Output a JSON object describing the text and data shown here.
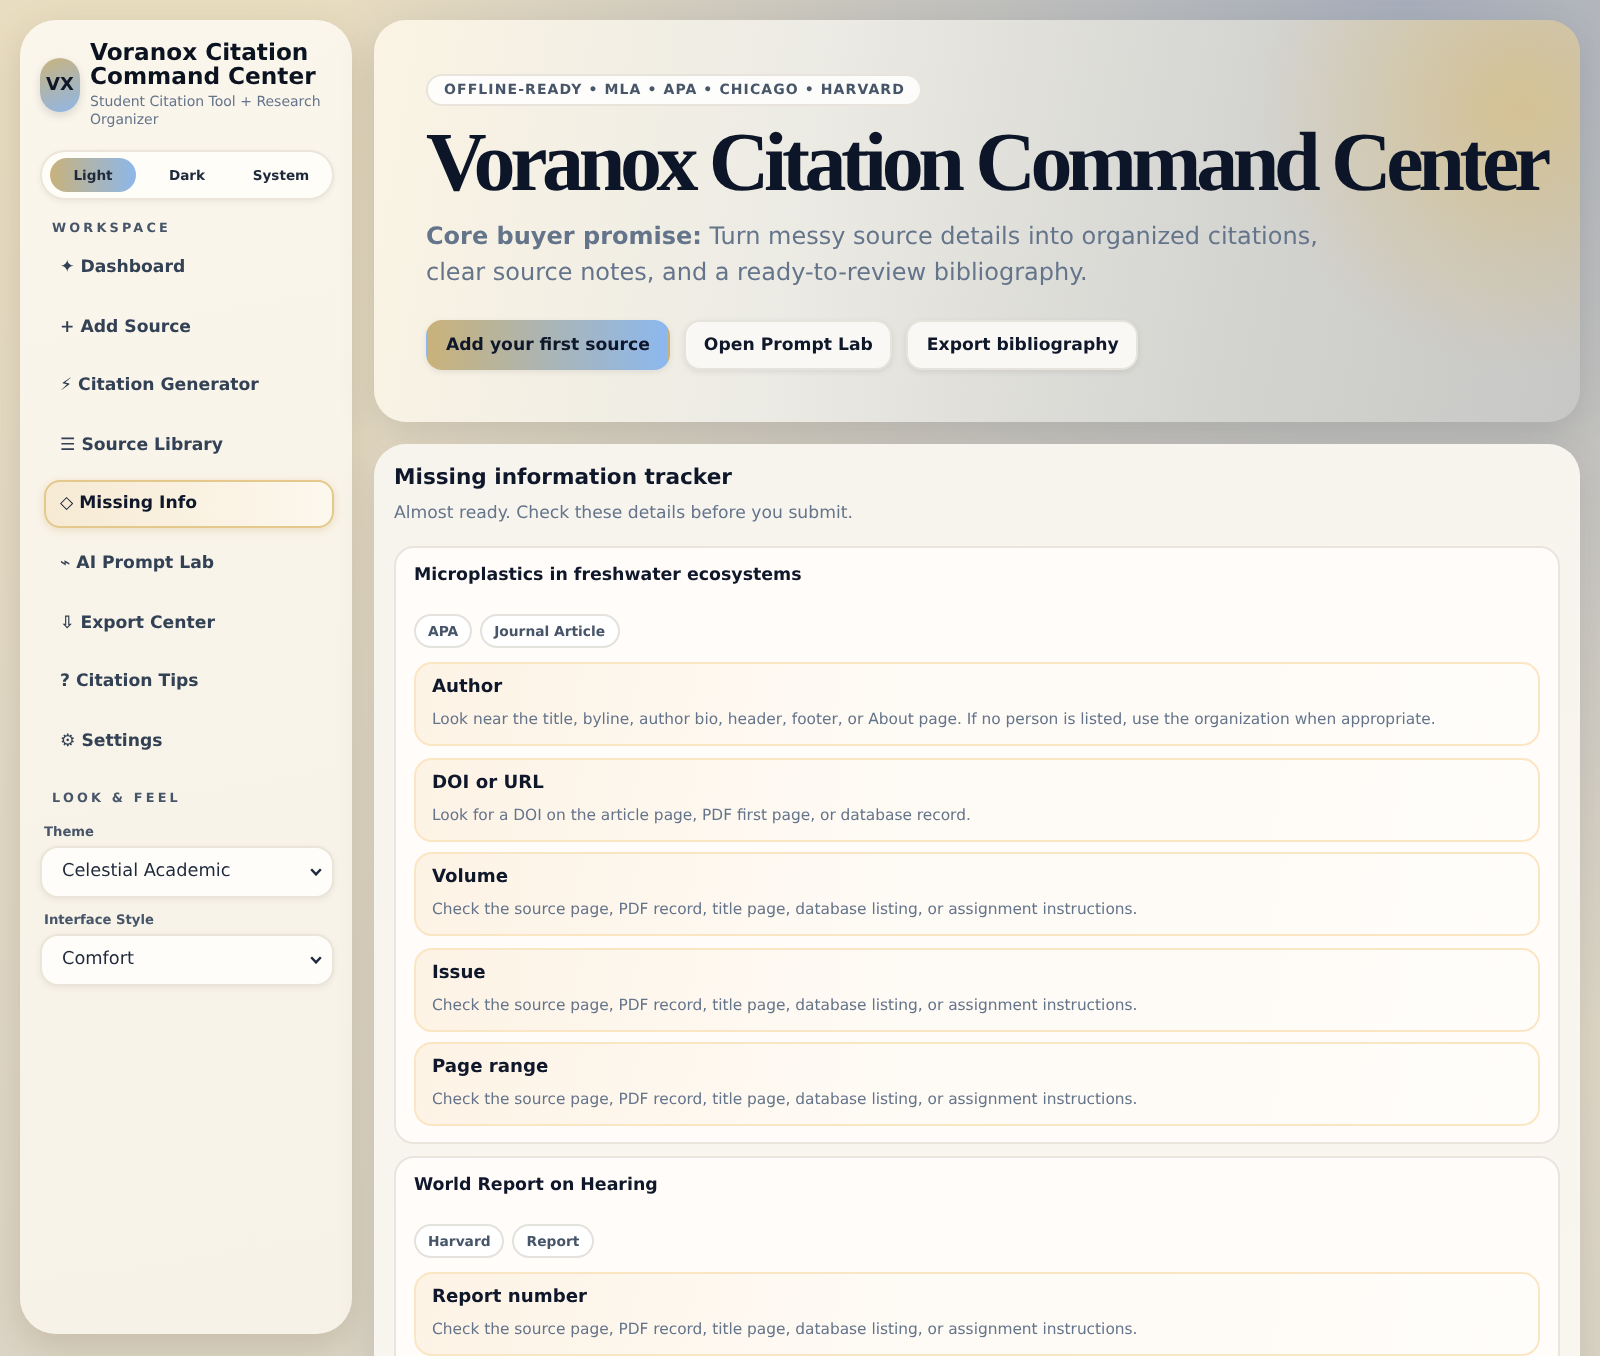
{
  "app": {
    "logo": "VX",
    "title": "Voranox Citation Command Center",
    "subtitle": "Student Citation Tool + Research Organizer"
  },
  "mode_switch": [
    {
      "label": "Light",
      "selected": true
    },
    {
      "label": "Dark",
      "selected": false
    },
    {
      "label": "System",
      "selected": false
    }
  ],
  "workspace": {
    "heading": "WORKSPACE",
    "items": [
      {
        "label": "✦ Dashboard",
        "selected": false
      },
      {
        "label": "+ Add Source",
        "selected": false
      },
      {
        "label": "⚡ Citation Generator",
        "selected": false
      },
      {
        "label": "☰ Source Library",
        "selected": false
      },
      {
        "label": "◇ Missing Info",
        "selected": true
      },
      {
        "label": "⌁ AI Prompt Lab",
        "selected": false
      },
      {
        "label": "⇩ Export Center",
        "selected": false
      },
      {
        "label": "? Citation Tips",
        "selected": false
      },
      {
        "label": "⚙ Settings",
        "selected": false
      }
    ]
  },
  "look_and_feel": {
    "heading": "LOOK & FEEL",
    "fields": [
      {
        "label": "Theme",
        "value": "Celestial Academic"
      },
      {
        "label": "Interface Style",
        "value": "Comfort"
      }
    ]
  },
  "hero": {
    "badge": "OFFLINE-READY • MLA • APA • CHICAGO • HARVARD",
    "title": "Voranox Citation Command Center",
    "promise": "**Core buyer promise:** Turn messy source details into organized citations, clear source notes, and a ready-to-review bibliography.",
    "buttons": [
      {
        "label": "Add your first source",
        "kind": "primary"
      },
      {
        "label": "Open Prompt Lab",
        "kind": "secondary"
      },
      {
        "label": "Export bibliography",
        "kind": "secondary"
      }
    ]
  },
  "tracker": {
    "title": "Missing information tracker",
    "subtitle": "Almost ready. Check these details before you submit.",
    "sources": [
      {
        "title": "Microplastics in freshwater ecosystems",
        "tags": [
          "APA",
          "Journal Article"
        ],
        "missing": [
          {
            "field": "Author",
            "hint": "Look near the title, byline, author bio, header, footer, or About page. If no person is listed, use the organization when appropriate."
          },
          {
            "field": "DOI or URL",
            "hint": "Look for a DOI on the article page, PDF first page, or database record."
          },
          {
            "field": "Volume",
            "hint": "Check the source page, PDF record, title page, database listing, or assignment instructions."
          },
          {
            "field": "Issue",
            "hint": "Check the source page, PDF record, title page, database listing, or assignment instructions."
          },
          {
            "field": "Page range",
            "hint": "Check the source page, PDF record, title page, database listing, or assignment instructions."
          }
        ]
      },
      {
        "title": "World Report on Hearing",
        "tags": [
          "Harvard",
          "Report"
        ],
        "missing": [
          {
            "field": "Report number",
            "hint": "Check the source page, PDF record, title page, database listing, or assignment instructions."
          }
        ]
      }
    ]
  }
}
